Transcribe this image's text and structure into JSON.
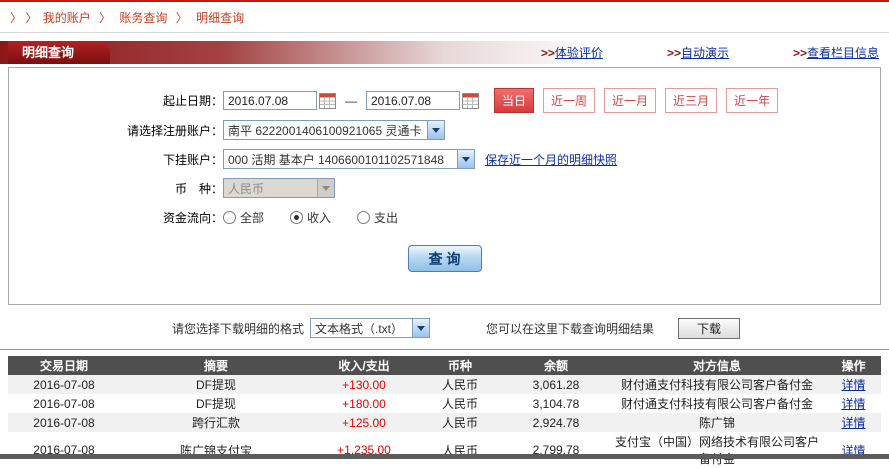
{
  "breadcrumb": {
    "prefix": "〉 〉",
    "separator": "〉",
    "items": [
      "我的账户",
      "账务查询",
      "明细查询"
    ]
  },
  "panel": {
    "title": "明细查询",
    "top_links": [
      {
        "prefix": ">>",
        "label": "体验评价"
      },
      {
        "prefix": ">>",
        "label": "自动演示"
      },
      {
        "prefix": ">>",
        "label": "查看栏目信息"
      }
    ]
  },
  "form": {
    "date_label": "起止日期：",
    "date_from": "2016.07.08",
    "date_to": "2016.07.08",
    "date_dash": "—",
    "quick_ranges": [
      "当日",
      "近一周",
      "近一月",
      "近三月",
      "近一年"
    ],
    "quick_active_index": 0,
    "account_label": "请选择注册账户：",
    "account_value": "南平 6222001406100921065 灵通卡",
    "sub_account_label": "下挂账户：",
    "sub_account_value": "000 活期 基本户 1406600101102571848",
    "snapshot_link": "保存近一个月的明细快照",
    "currency_label": "币　种：",
    "currency_value": "人民币",
    "flow_label": "资金流向：",
    "flow_options": [
      "全部",
      "收入",
      "支出"
    ],
    "flow_selected_index": 1,
    "query_button": "查 询"
  },
  "download": {
    "format_label": "请您选择下载明细的格式",
    "format_value": "文本格式（.txt）",
    "hint": "您可以在这里下载查询明细结果",
    "button": "下载"
  },
  "table": {
    "headers": [
      "交易日期",
      "摘要",
      "收入/支出",
      "币种",
      "余额",
      "对方信息",
      "操作"
    ],
    "rows": [
      [
        "2016-07-08",
        "DF提现",
        "+130.00",
        "人民币",
        "3,061.28",
        "财付通支付科技有限公司客户备付金",
        "详情"
      ],
      [
        "2016-07-08",
        "DF提现",
        "+180.00",
        "人民币",
        "3,104.78",
        "财付通支付科技有限公司客户备付金",
        "详情"
      ],
      [
        "2016-07-08",
        "跨行汇款",
        "+125.00",
        "人民币",
        "2,924.78",
        "陈广锦",
        "详情"
      ],
      [
        "2016-07-08",
        "陈广锦支付宝",
        "+1,235.00",
        "人民币",
        "2,799.78",
        "支付宝（中国）网络技术有限公司客户备付金",
        "详情"
      ]
    ]
  },
  "colors": {
    "accent_red": "#cf1212",
    "link_blue": "#0a2fa0",
    "table_header_gray": "#4f4f4f",
    "amount_red": "#e50000"
  }
}
